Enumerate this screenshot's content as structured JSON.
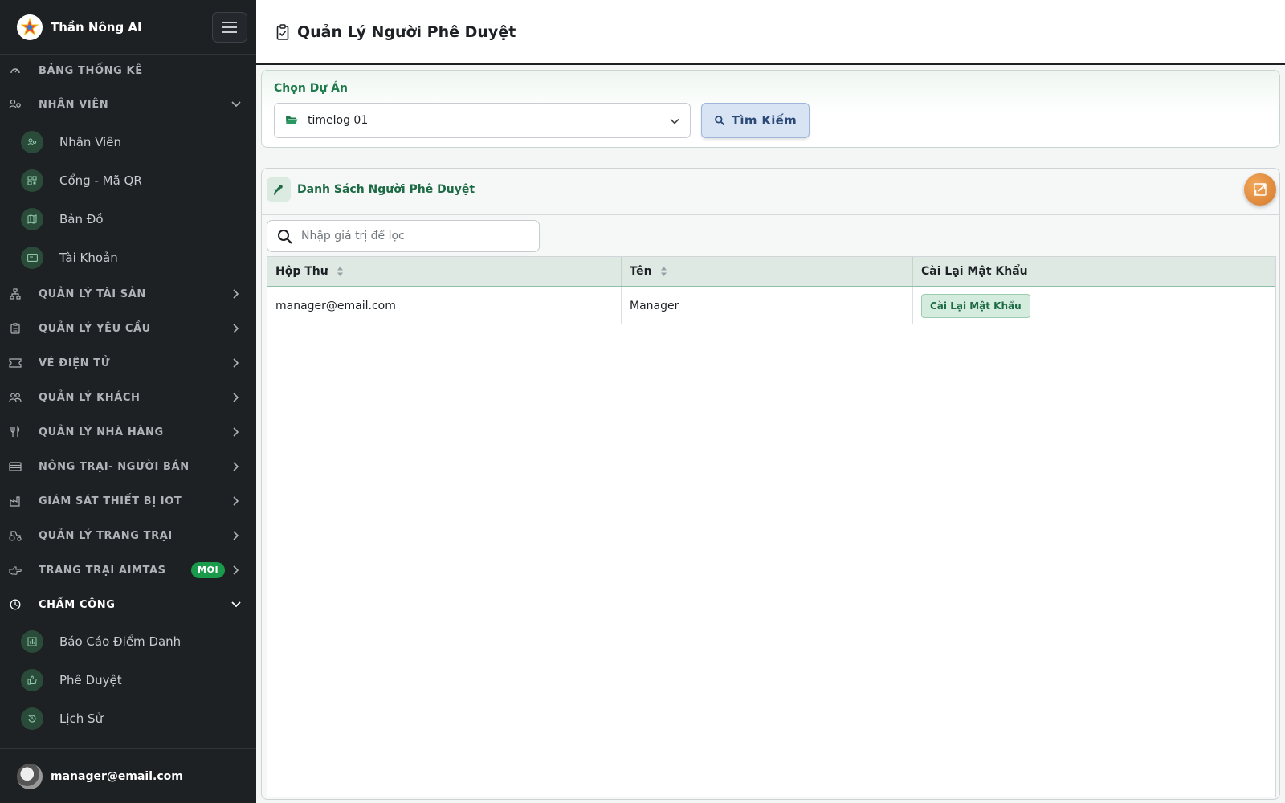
{
  "app": {
    "name": "Thần Nông AI"
  },
  "sidebar": {
    "items": [
      {
        "label": "BẢNG THỐNG KÊ",
        "icon": "gauge-icon",
        "chevron": "none"
      },
      {
        "label": "NHÂN VIÊN",
        "icon": "users-gear-icon",
        "chevron": "down"
      },
      {
        "label": "QUẢN LÝ TÀI SẢN",
        "icon": "hierarchy-icon",
        "chevron": "right"
      },
      {
        "label": "QUẢN LÝ YÊU CẦU",
        "icon": "clipboard-icon",
        "chevron": "right"
      },
      {
        "label": "VÉ ĐIỆN TỬ",
        "icon": "ticket-icon",
        "chevron": "right"
      },
      {
        "label": "QUẢN LÝ KHÁCH",
        "icon": "people-icon",
        "chevron": "right"
      },
      {
        "label": "QUẢN LÝ NHÀ HÀNG",
        "icon": "utensils-icon",
        "chevron": "right"
      },
      {
        "label": "NÔNG TRẠI- NGƯỜI BÁN",
        "icon": "store-icon",
        "chevron": "right"
      },
      {
        "label": "GIÁM SÁT THIẾT BỊ IOT",
        "icon": "factory-icon",
        "chevron": "right"
      },
      {
        "label": "QUẢN LÝ TRANG TRẠI",
        "icon": "tractor-icon",
        "chevron": "right"
      },
      {
        "label": "TRANG TRẠI AIMTAS",
        "icon": "hand-point-icon",
        "chevron": "right",
        "badge": "MỚI"
      },
      {
        "label": "CHẤM CÔNG",
        "icon": "clock-icon",
        "chevron": "down"
      }
    ],
    "staff_subitems": [
      {
        "label": "Nhân Viên",
        "icon": "users-gear-icon"
      },
      {
        "label": "Cổng - Mã QR",
        "icon": "qrcode-icon"
      },
      {
        "label": "Bản Đồ",
        "icon": "map-icon"
      },
      {
        "label": "Tài Khoản",
        "icon": "id-card-icon"
      }
    ],
    "attendance_subitems": [
      {
        "label": "Báo Cáo Điểm Danh",
        "icon": "bar-chart-icon"
      },
      {
        "label": "Phê Duyệt",
        "icon": "thumbs-up-icon"
      },
      {
        "label": "Lịch Sử",
        "icon": "history-icon"
      }
    ],
    "user": {
      "email": "manager@email.com"
    }
  },
  "header": {
    "title": "Quản Lý Người Phê Duyệt"
  },
  "filter": {
    "label": "Chọn Dự Án",
    "selected_project": "timelog 01",
    "search_button": "Tìm Kiếm"
  },
  "approvers": {
    "title": "Danh Sách Người Phê Duyệt",
    "filter_placeholder": "Nhập giá trị để lọc",
    "columns": [
      "Hộp Thư",
      "Tên",
      "Cài Lại Mật Khẩu"
    ],
    "rows": [
      {
        "email": "manager@email.com",
        "name": "Manager",
        "action": "Cài Lại Mật Khẩu"
      }
    ]
  },
  "colors": {
    "sidebar_bg": "#1e2124",
    "accent_green": "#1d7a4a",
    "new_badge": "#1a9a4b",
    "search_button_bg": "#d8e4f4"
  }
}
